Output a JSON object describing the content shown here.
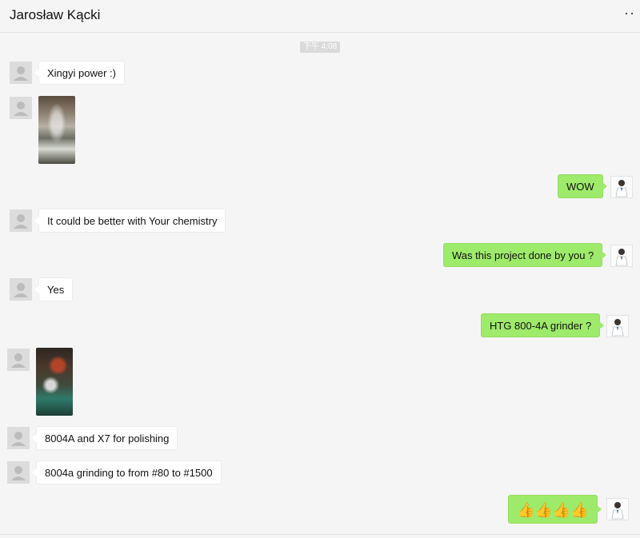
{
  "header": {
    "title": "Jarosław Kącki",
    "more": "··"
  },
  "timestamp": "下午 4:08",
  "messages": [
    {
      "side": "in",
      "kind": "text",
      "text": "Xingyi power :)"
    },
    {
      "side": "in",
      "kind": "image",
      "alt": "photo"
    },
    {
      "side": "out",
      "kind": "text",
      "text": "WOW"
    },
    {
      "side": "in",
      "kind": "text",
      "text": "It could be better with Your chemistry"
    },
    {
      "side": "out",
      "kind": "text",
      "text": "Was this project done by you ?"
    },
    {
      "side": "in",
      "kind": "text",
      "text": "Yes"
    },
    {
      "side": "out",
      "kind": "text",
      "text": "HTG 800-4A grinder ?"
    },
    {
      "side": "in",
      "kind": "image",
      "alt": "photo"
    },
    {
      "side": "in",
      "kind": "text",
      "text": "8004A and X7 for polishing"
    },
    {
      "side": "in",
      "kind": "text",
      "text": "8004a grinding to from #80 to #1500"
    },
    {
      "side": "out",
      "kind": "emoji",
      "text": "👍👍👍👍"
    }
  ],
  "icons": {
    "contact_avatar": "person-placeholder-icon",
    "self_avatar": "user-avatar-photo",
    "more": "more-options-icon"
  },
  "colors": {
    "outgoing_bubble": "#9eea6a",
    "incoming_bubble": "#ffffff",
    "background": "#f5f5f5"
  }
}
